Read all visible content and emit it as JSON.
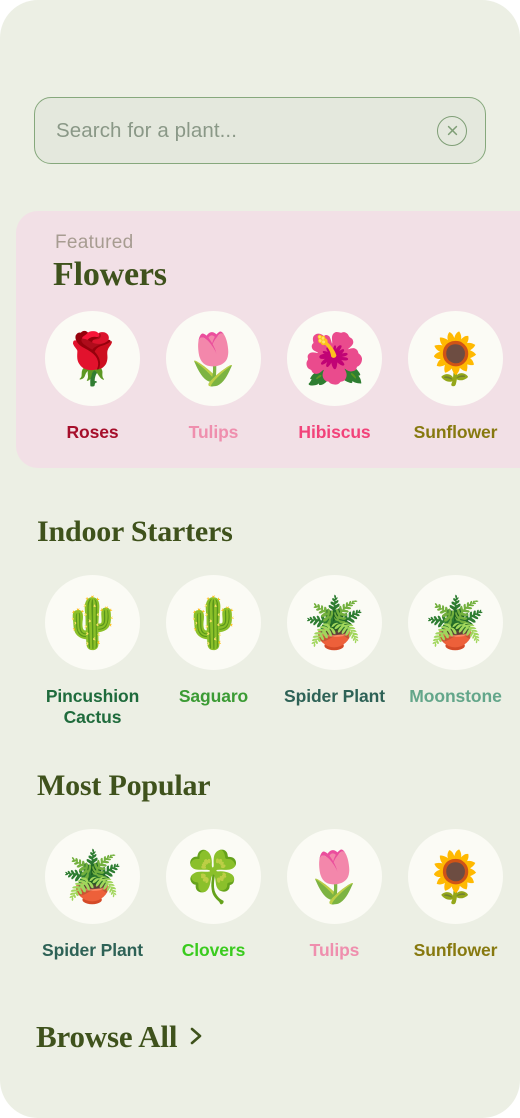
{
  "theme": {
    "page_bg": "#ECEFE4",
    "featured_card_bg": "#F2E0E6",
    "circle_bg": "#FBFBF5",
    "heading_green": "#3F521C",
    "search_border": "#86A87C",
    "search_fill": "#E4E8DD"
  },
  "search": {
    "placeholder": "Search for a plant...",
    "value": "",
    "clear_icon": "close-circle-icon"
  },
  "featured": {
    "kicker": "Featured",
    "title": "Flowers",
    "items": [
      {
        "emoji": "🌹",
        "icon_name": "rose-emoji",
        "label": "Roses",
        "color": "#A60F2B"
      },
      {
        "emoji": "🌷",
        "icon_name": "tulip-emoji",
        "label": "Tulips",
        "color": "#EF8FAE"
      },
      {
        "emoji": "🌺",
        "icon_name": "hibiscus-emoji",
        "label": "Hibiscus",
        "color": "#F2437A"
      },
      {
        "emoji": "🌻",
        "icon_name": "sunflower-emoji",
        "label": "Sunflower",
        "color": "#87790F"
      }
    ]
  },
  "sections": [
    {
      "id": "indoor",
      "title": "Indoor Starters",
      "items": [
        {
          "emoji": "🌵",
          "icon_name": "potted-cactus-emoji",
          "label": "Pincushion Cactus",
          "color": "#1F6B3C"
        },
        {
          "emoji": "🌵",
          "icon_name": "cactus-emoji",
          "label": "Saguaro",
          "color": "#3B9B34"
        },
        {
          "emoji": "🪴",
          "icon_name": "potted-plant-emoji",
          "label": "Spider Plant",
          "color": "#2E6256"
        },
        {
          "emoji": "🪴",
          "icon_name": "succulent-emoji",
          "label": "Moonstone",
          "color": "#63A68A"
        }
      ]
    },
    {
      "id": "popular",
      "title": "Most Popular",
      "items": [
        {
          "emoji": "🪴",
          "icon_name": "potted-plant-emoji",
          "label": "Spider Plant",
          "color": "#2E6256"
        },
        {
          "emoji": "🍀",
          "icon_name": "four-leaf-clover-emoji",
          "label": "Clovers",
          "color": "#3ACB1E"
        },
        {
          "emoji": "🌷",
          "icon_name": "tulip-emoji",
          "label": "Tulips",
          "color": "#EF8FAE"
        },
        {
          "emoji": "🌻",
          "icon_name": "sunflower-emoji",
          "label": "Sunflower",
          "color": "#87790F"
        },
        {
          "emoji": "🌱",
          "icon_name": "seedling-emoji",
          "label": "",
          "color": "#3F521C"
        }
      ]
    }
  ],
  "browse_all": {
    "label": "Browse All",
    "chevron_icon": "chevron-right-icon"
  }
}
